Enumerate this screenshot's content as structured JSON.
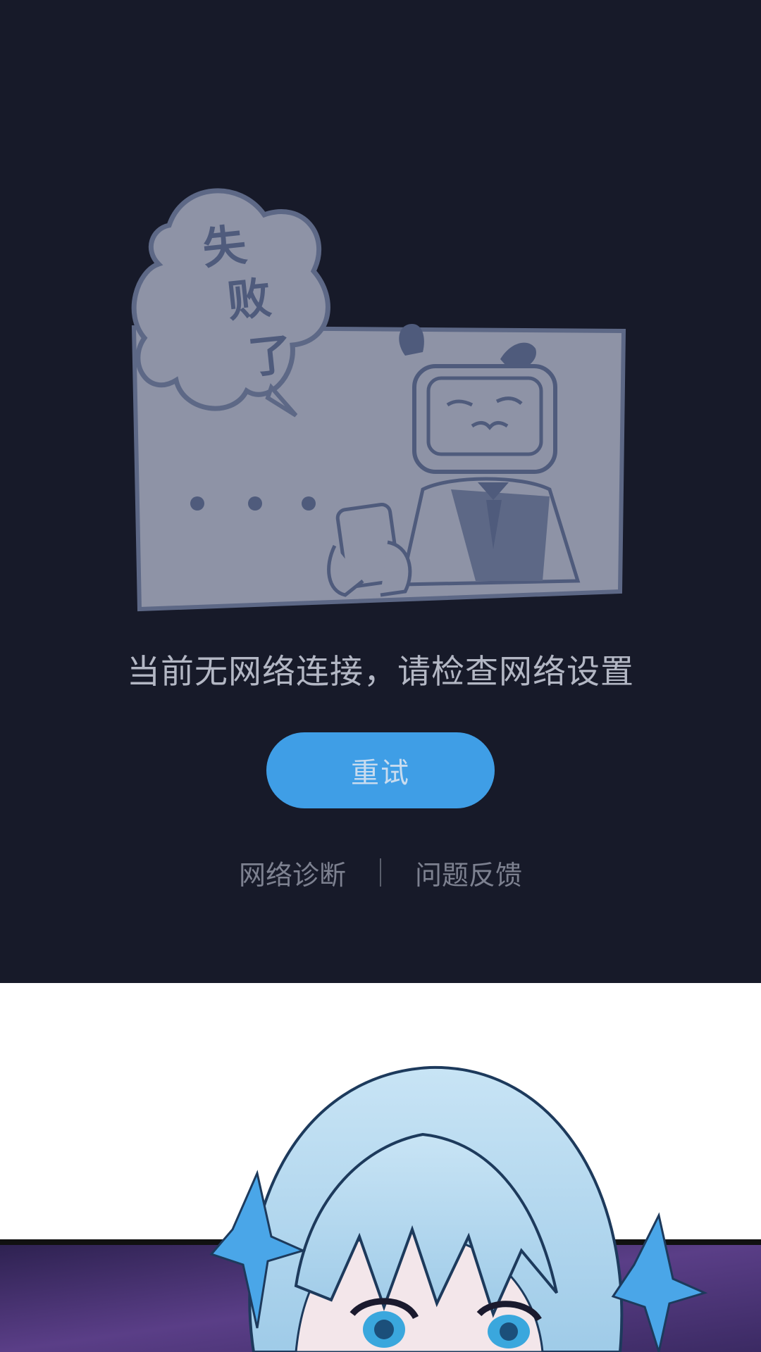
{
  "error_page": {
    "illustration_caption": "失败了",
    "message": "当前无网络连接，请检查网络设置",
    "retry_label": "重试",
    "footer": {
      "diagnose_label": "网络诊断",
      "feedback_label": "问题反馈"
    }
  },
  "colors": {
    "background": "#171a29",
    "accent": "#3f9ee6",
    "message_text": "#b3b7c4",
    "footer_text": "#7d8190"
  },
  "icons": {
    "illustration": "tv-head-character-holding-phone",
    "comic": "anime-girl-comic-panel"
  }
}
